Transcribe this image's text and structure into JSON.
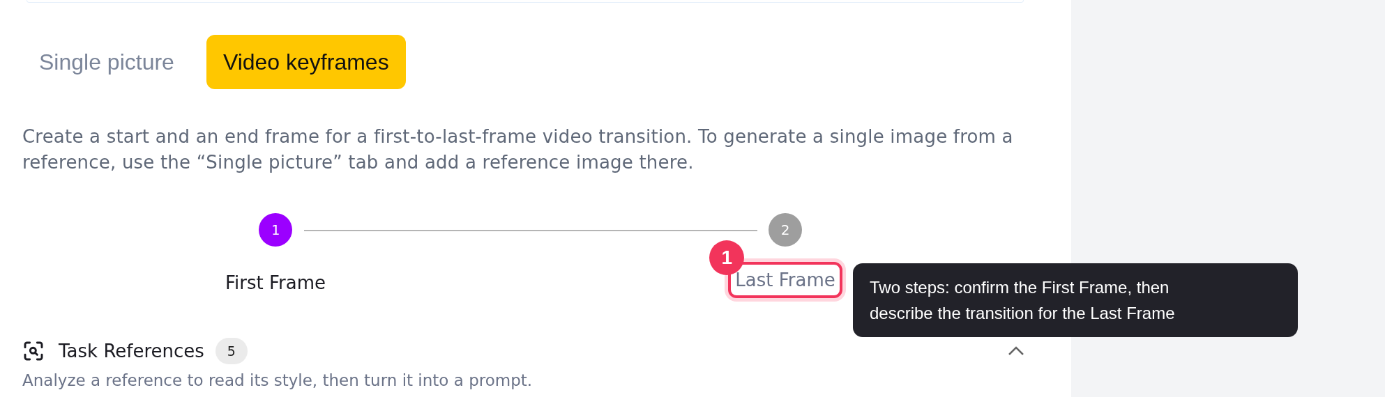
{
  "tabs": [
    {
      "label": "Single picture",
      "selected": false
    },
    {
      "label": "Video keyframes",
      "selected": true
    }
  ],
  "description": "Create a start and an end frame for a first-to-last-frame video transition. To generate a single image from a reference, use the “Single picture” tab and add a reference image there.",
  "steps": [
    {
      "number": "1",
      "label": "First Frame",
      "selected": true,
      "highlighted": false
    },
    {
      "number": "2",
      "label": "Last Frame",
      "selected": false,
      "highlighted": true
    }
  ],
  "callout": {
    "number": "1",
    "text": "Two steps: confirm the First Frame, then describe the transition for the Last Frame"
  },
  "task_references": {
    "title": "Task References",
    "count": "5",
    "expanded": true,
    "description": "Analyze a reference to read its style, then turn it into a prompt."
  }
}
